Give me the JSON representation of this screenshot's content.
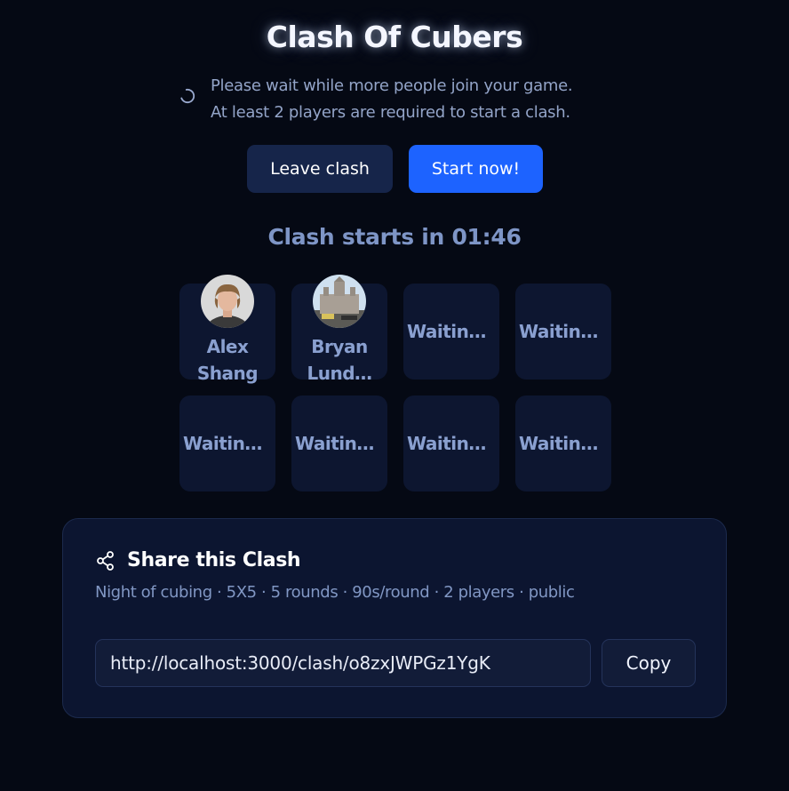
{
  "header": {
    "title": "Clash Of Cubers"
  },
  "waiting": {
    "line1": "Please wait while more people join your game.",
    "line2": "At least 2 players are required to start a clash."
  },
  "actions": {
    "leave_label": "Leave clash",
    "start_label": "Start now!"
  },
  "countdown": {
    "text": "Clash starts in 01:46"
  },
  "players": [
    {
      "first": "Alex",
      "last": "Shang"
    },
    {
      "first": "Bryan",
      "last": "Lund…"
    }
  ],
  "empty_slots": [
    "Waiting…",
    "Waiting…",
    "Waiting…",
    "Waiting…",
    "Waiting…",
    "Waiting…"
  ],
  "share": {
    "title": "Share this Clash",
    "meta": "Night of cubing · 5X5 · 5 rounds · 90s/round · 2 players · public",
    "url": "http://localhost:3000/clash/o8zxJWPGz1YgK",
    "copy_label": "Copy"
  },
  "colors": {
    "background": "#050914",
    "accent": "#1d63ff",
    "card": "#0d1630",
    "muted_text": "#8aa0d0"
  }
}
